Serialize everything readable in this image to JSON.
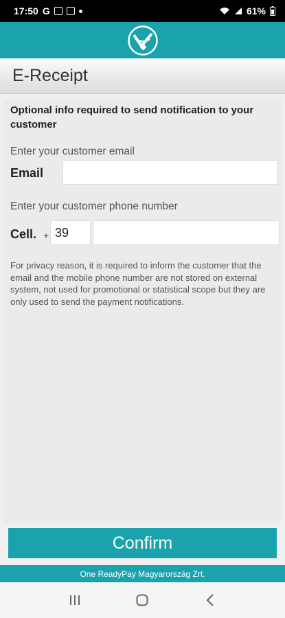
{
  "status_bar": {
    "time": "17:50",
    "left_icons": [
      "G",
      "image-icon",
      "calendar-check-icon",
      "dot"
    ],
    "battery": "61%",
    "right_icons": [
      "wifi-icon",
      "signal-icon",
      "battery-icon"
    ]
  },
  "header": {
    "logo": "app-logo"
  },
  "title": "E-Receipt",
  "form": {
    "intro": "Optional info required to send notification to your customer",
    "email_hint": "Enter your customer email",
    "email_label": "Email",
    "email_value": "",
    "phone_hint": "Enter your customer phone number",
    "cell_label": "Cell.",
    "plus_sign": "+",
    "country_code": "39",
    "phone_value": "",
    "privacy_text": "For privacy reason, it is required to inform the customer that the email and the mobile phone number are not stored on external system, not used for promotional or statistical scope but they are only used to send the payment notifications."
  },
  "confirm_label": "Confirm",
  "footer": "One ReadyPay Magyarország Zrt.",
  "colors": {
    "accent": "#1ba3ad",
    "background": "#ebebeb"
  }
}
